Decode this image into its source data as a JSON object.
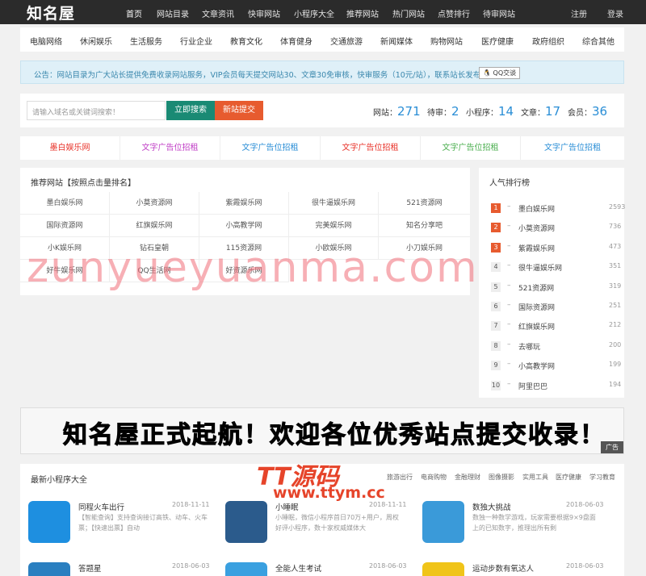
{
  "header": {
    "logo": "知名屋",
    "nav": [
      "首页",
      "网站目录",
      "文章资讯",
      "快审网站",
      "小程序大全",
      "推荐网站",
      "热门网站",
      "点赞排行",
      "待审网站"
    ],
    "register": "注册",
    "login": "登录"
  },
  "categories": [
    "电脑网络",
    "休闲娱乐",
    "生活服务",
    "行业企业",
    "教育文化",
    "体育健身",
    "交通旅游",
    "新闻媒体",
    "购物网站",
    "医疗健康",
    "政府组织",
    "综合其他"
  ],
  "notice": {
    "text": "公告：网站目录为广大站长提供免费收录网站服务，VIP会员每天提交网站30、文章30免审核，快审服务（10元/站），联系站长发布。",
    "qq_label": "QQ交谈"
  },
  "search": {
    "placeholder": "请输入域名或关键词搜索！",
    "search_button": "立即搜索",
    "submit_button": "新站提交"
  },
  "stats": [
    {
      "label": "网站：",
      "value": "271"
    },
    {
      "label": "待审：",
      "value": "2"
    },
    {
      "label": "小程序：",
      "value": "14"
    },
    {
      "label": "文章：",
      "value": "17"
    },
    {
      "label": "会员：",
      "value": "36"
    }
  ],
  "ads": [
    {
      "text": "墨白娱乐网",
      "color": "#e8332a"
    },
    {
      "text": "文字广告位招租",
      "color": "#c03fc6"
    },
    {
      "text": "文字广告位招租",
      "color": "#2a8ed6"
    },
    {
      "text": "文字广告位招租",
      "color": "#e8332a"
    },
    {
      "text": "文字广告位招租",
      "color": "#4caf50"
    },
    {
      "text": "文字广告位招租",
      "color": "#2a8ed6"
    }
  ],
  "recommend": {
    "title": "推荐网站【按照点击量排名】",
    "sites": [
      "墨白娱乐网",
      "小莫资源网",
      "紫霞娱乐网",
      "很牛逼娱乐网",
      "521资源网",
      "国际资源网",
      "红旗娱乐网",
      "小高教学网",
      "完美娱乐网",
      "知名分享吧",
      "小K娱乐网",
      "钻石皇朝",
      "115资源网",
      "小欧娱乐网",
      "小刀娱乐网",
      "好牛娱乐网",
      "QQ生活网",
      "好资源乐网"
    ]
  },
  "ranking": {
    "title": "人气排行榜",
    "items": [
      {
        "no": "1",
        "name": "墨白娱乐网",
        "count": "2593"
      },
      {
        "no": "2",
        "name": "小莫资源网",
        "count": "736"
      },
      {
        "no": "3",
        "name": "紫霞娱乐网",
        "count": "473"
      },
      {
        "no": "4",
        "name": "很牛逼娱乐网",
        "count": "351"
      },
      {
        "no": "5",
        "name": "521资源网",
        "count": "319"
      },
      {
        "no": "6",
        "name": "国际资源网",
        "count": "251"
      },
      {
        "no": "7",
        "name": "红旗娱乐网",
        "count": "212"
      },
      {
        "no": "8",
        "name": "去哪玩",
        "count": "200"
      },
      {
        "no": "9",
        "name": "小高教学网",
        "count": "199"
      },
      {
        "no": "10",
        "name": "阿里巴巴",
        "count": "194"
      }
    ]
  },
  "banner": {
    "text": "知名屋正式起航！欢迎各位优秀站点提交收录！",
    "tag": "广告"
  },
  "miniprograms": {
    "title": "最新小程序大全",
    "tabs": [
      "旅游出行",
      "电商购物",
      "金融理财",
      "图像摄影",
      "实用工具",
      "医疗健康",
      "学习教育"
    ],
    "apps": [
      {
        "name": "同程火车出行",
        "date": "2018-11-11",
        "desc": "【智能查询】支持查询接订高铁、动车、火车票；【快速出票】自动",
        "icon_color": "#1e8fe0"
      },
      {
        "name": "小睡眠",
        "date": "2018-11-11",
        "desc": "小睡眠，微信小程序首日70万+用户，周权好评小程序，数十家权威媒体大",
        "icon_color": "#2b5b8c"
      },
      {
        "name": "数独大挑战",
        "date": "2018-06-03",
        "desc": "数独一种数学游戏，玩家需要根据9×9盘面上的已知数字，推理出所有剩",
        "icon_color": "#3a9ad9"
      },
      {
        "name": "答题星",
        "date": "2018-06-03",
        "desc": "",
        "icon_color": "#2a7fc0"
      },
      {
        "name": "全能人生考试",
        "date": "2018-06-03",
        "desc": "",
        "icon_color": "#3aa0e0"
      },
      {
        "name": "运动步数有氧达人",
        "date": "2018-06-03",
        "desc": "",
        "icon_color": "#f0c419"
      }
    ]
  },
  "watermarks": {
    "main": "zunyueyuanma.com",
    "brand": "TT源码",
    "url": "www.ttym.cc"
  }
}
